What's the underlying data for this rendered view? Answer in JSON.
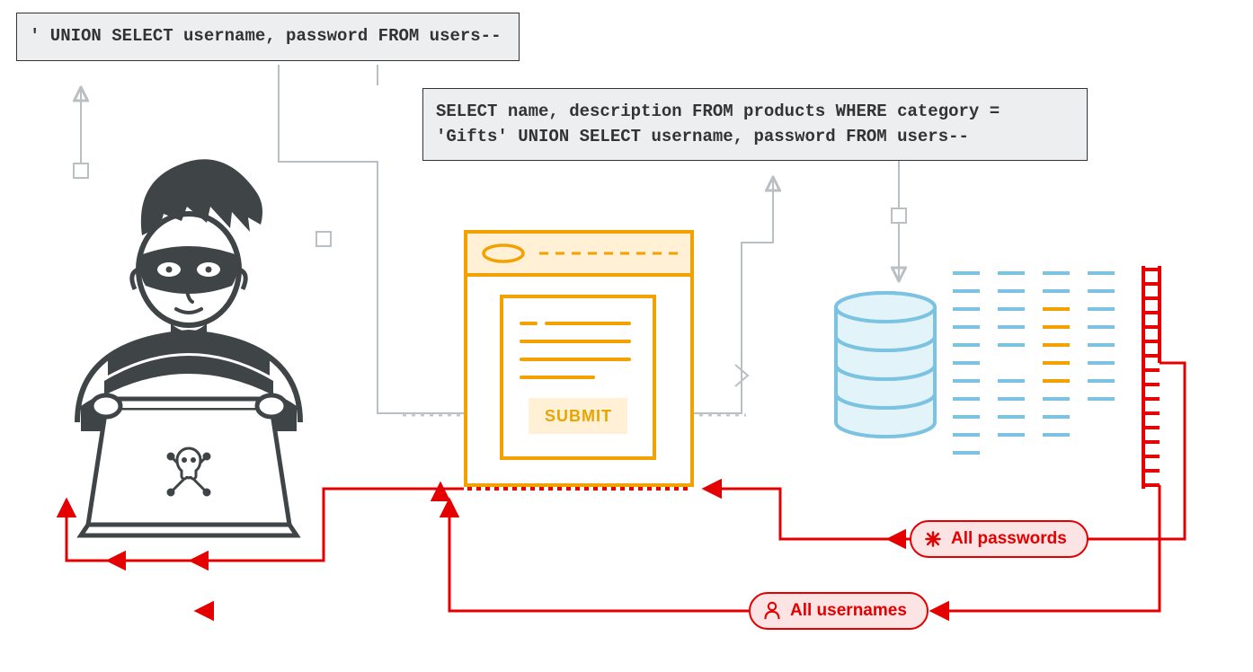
{
  "diagram": {
    "attacker_input": "' UNION SELECT username, password FROM users--",
    "server_query": "SELECT name, description FROM products WHERE category = 'Gifts' UNION SELECT username, password FROM users--",
    "form_button": "SUBMIT",
    "leak_passwords": "All passwords",
    "leak_usernames": "All usernames"
  },
  "colors": {
    "gray": "#b9bfc2",
    "orange": "#f2a100",
    "orange_fill": "#fff0d6",
    "blue": "#7bc3e0",
    "blue_fill": "#e3f3fa",
    "red": "#e40000",
    "red_fill": "#fde4e4",
    "ink": "#3f4447"
  }
}
